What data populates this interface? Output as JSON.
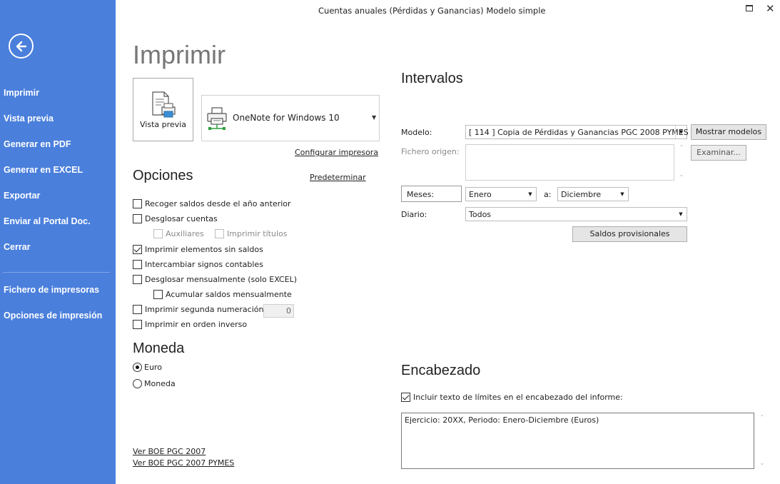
{
  "window": {
    "title": "Cuentas anuales (Pérdidas y Ganancias) Modelo simple"
  },
  "sidebar": {
    "items": [
      {
        "label": "Imprimir"
      },
      {
        "label": "Vista previa"
      },
      {
        "label": "Generar en PDF"
      },
      {
        "label": "Generar en EXCEL"
      },
      {
        "label": "Exportar"
      },
      {
        "label": "Enviar al Portal Doc."
      },
      {
        "label": "Cerrar"
      }
    ],
    "secondary": [
      {
        "label": "Fichero de impresoras"
      },
      {
        "label": "Opciones de impresión"
      }
    ]
  },
  "print": {
    "title": "Imprimir",
    "preview_label": "Vista previa",
    "printer_name": "OneNote for Windows 10",
    "configure_link": "Configurar impresora"
  },
  "options": {
    "title": "Opciones",
    "default_link": "Predeterminar",
    "items": [
      {
        "label": "Recoger saldos desde el año anterior",
        "checked": false
      },
      {
        "label": "Desglosar cuentas",
        "checked": false
      },
      {
        "label": "Auxiliares",
        "checked": false,
        "disabled": true
      },
      {
        "label": "Imprimir títulos",
        "checked": false,
        "disabled": true
      },
      {
        "label": "Imprimir elementos sin saldos",
        "checked": true
      },
      {
        "label": "Intercambiar signos contables",
        "checked": false
      },
      {
        "label": "Desglosar mensualmente (solo EXCEL)",
        "checked": false
      },
      {
        "label": "Acumular saldos mensualmente",
        "checked": false
      },
      {
        "label": "Imprimir segunda numeración:",
        "checked": false
      },
      {
        "label": "Imprimir en orden inverso",
        "checked": false
      }
    ],
    "second_numbering_value": "0"
  },
  "currency": {
    "title": "Moneda",
    "options": [
      {
        "label": "Euro",
        "selected": true
      },
      {
        "label": "Moneda",
        "selected": false
      }
    ]
  },
  "links": {
    "boe_2007": "Ver BOE PGC 2007",
    "boe_2007_pymes": "Ver BOE PGC 2007 PYMES"
  },
  "intervals": {
    "title": "Intervalos",
    "model_label": "Modelo:",
    "model_value": "[ 114 ] Copia de Pérdidas y Ganancias PGC 2008 PYMES",
    "show_models_button": "Mostrar modelos",
    "source_file_label": "Fichero origen:",
    "browse_button": "Examinar...",
    "months_label": "Meses:",
    "month_from": "Enero",
    "to_label": "a:",
    "month_to": "Diciembre",
    "journal_label": "Diario:",
    "journal_value": "Todos",
    "provisional_button": "Saldos provisionales"
  },
  "header": {
    "title": "Encabezado",
    "include_limits_label": "Incluir texto de límites en el encabezado del informe:",
    "include_limits_checked": true,
    "text": "Ejercicio: 20XX, Periodo: Enero-Diciembre (Euros)"
  }
}
